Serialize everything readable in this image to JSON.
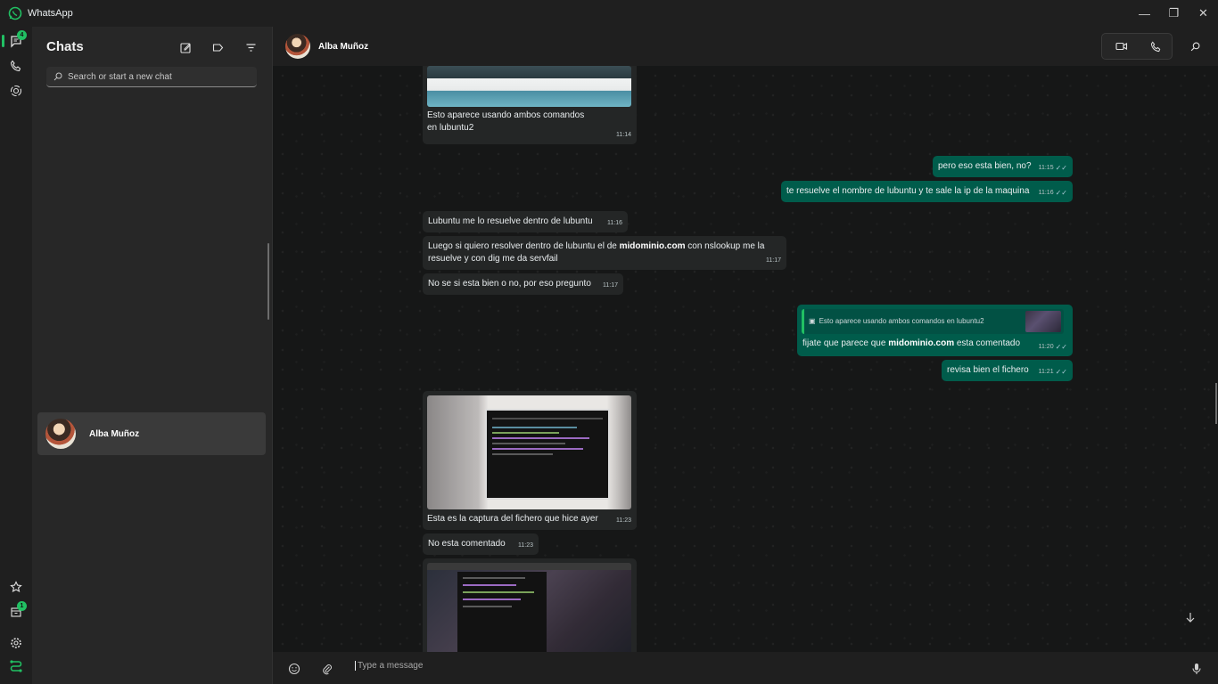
{
  "app": {
    "title": "WhatsApp"
  },
  "window_controls": {
    "minimize": "—",
    "restore": "❐",
    "close": "✕"
  },
  "rail": {
    "chats_badge": "4",
    "archive_badge": "1"
  },
  "sidebar": {
    "title": "Chats",
    "search_placeholder": "Search or start a new chat",
    "chats": [
      {
        "name": "Alba Muñoz"
      }
    ]
  },
  "header": {
    "contact_name": "Alba Muñoz"
  },
  "messages": [
    {
      "dir": "in",
      "type": "image",
      "text_line1": "Esto aparece usando ambos comandos",
      "text_line2": "en lubuntu2",
      "time": "11:14"
    },
    {
      "dir": "out",
      "text": "pero eso esta bien, no?",
      "time": "11:15"
    },
    {
      "dir": "out",
      "text": "te resuelve el nombre de lubuntu y te sale la ip de la maquina",
      "time": "11:16"
    },
    {
      "dir": "in",
      "text": "Lubuntu me lo resuelve dentro de lubuntu",
      "time": "11:16"
    },
    {
      "dir": "in",
      "text_pre": "Luego si quiero resolver dentro de lubuntu el de ",
      "link": "midominio.com",
      "text_post": " con nslookup me la",
      "text_line2": "resuelve y con dig me da servfail",
      "time": "11:17"
    },
    {
      "dir": "in",
      "text": "No se si esta bien o no, por eso pregunto",
      "time": "11:17"
    },
    {
      "dir": "out",
      "quote": "Esto aparece usando ambos comandos en lubuntu2",
      "text_pre": "fijate que parece que ",
      "link": "midominio.com",
      "text_post": " esta comentado",
      "time": "11:20"
    },
    {
      "dir": "out",
      "text": "revisa bien el fichero",
      "time": "11:21"
    },
    {
      "dir": "in",
      "type": "image",
      "text": "Esta es la captura del fichero que hice ayer",
      "time": "11:23"
    },
    {
      "dir": "in",
      "text": "No esta comentado",
      "time": "11:23"
    },
    {
      "dir": "in",
      "type": "image"
    }
  ],
  "composer": {
    "placeholder": "Type a message"
  },
  "colors": {
    "accent": "#21c063",
    "outgoing_bubble": "#005c4b",
    "incoming_bubble": "#242626",
    "background": "#161717"
  }
}
